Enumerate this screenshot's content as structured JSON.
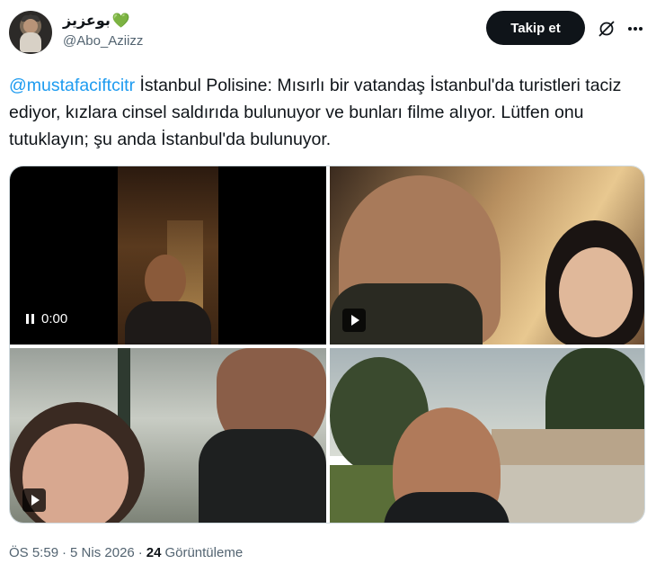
{
  "author": {
    "display_name": "بوعزيز",
    "emoji": "💚",
    "handle": "@Abo_Aziizz",
    "avatar_icon": "avatar-image"
  },
  "actions": {
    "follow_label": "Takip et",
    "grok_icon": "grok-icon",
    "more_icon": "more-icon"
  },
  "tweet": {
    "mention": "@mustafaciftcitr",
    "text": " İstanbul Polisine: Mısırlı bir vatandaş İstanbul'da turistleri taciz ediyor, kızlara cinsel saldırıda bulunuyor ve bunları filme alıyor. Lütfen onu tutuklayın; şu anda İstanbul'da bulunuyor."
  },
  "media": {
    "video1_time": "0:00",
    "video_icons": [
      "pause-icon",
      "play-icon",
      "play-icon",
      "play-icon"
    ]
  },
  "meta": {
    "time": "ÖS 5:59",
    "sep1": "·",
    "date": "5 Nis 2026",
    "sep2": "·",
    "views_count": "24",
    "views_label": "Görüntüleme"
  },
  "colors": {
    "accent": "#1d9bf0",
    "text": "#0f1419",
    "muted": "#536471",
    "heart": "#78b159"
  }
}
